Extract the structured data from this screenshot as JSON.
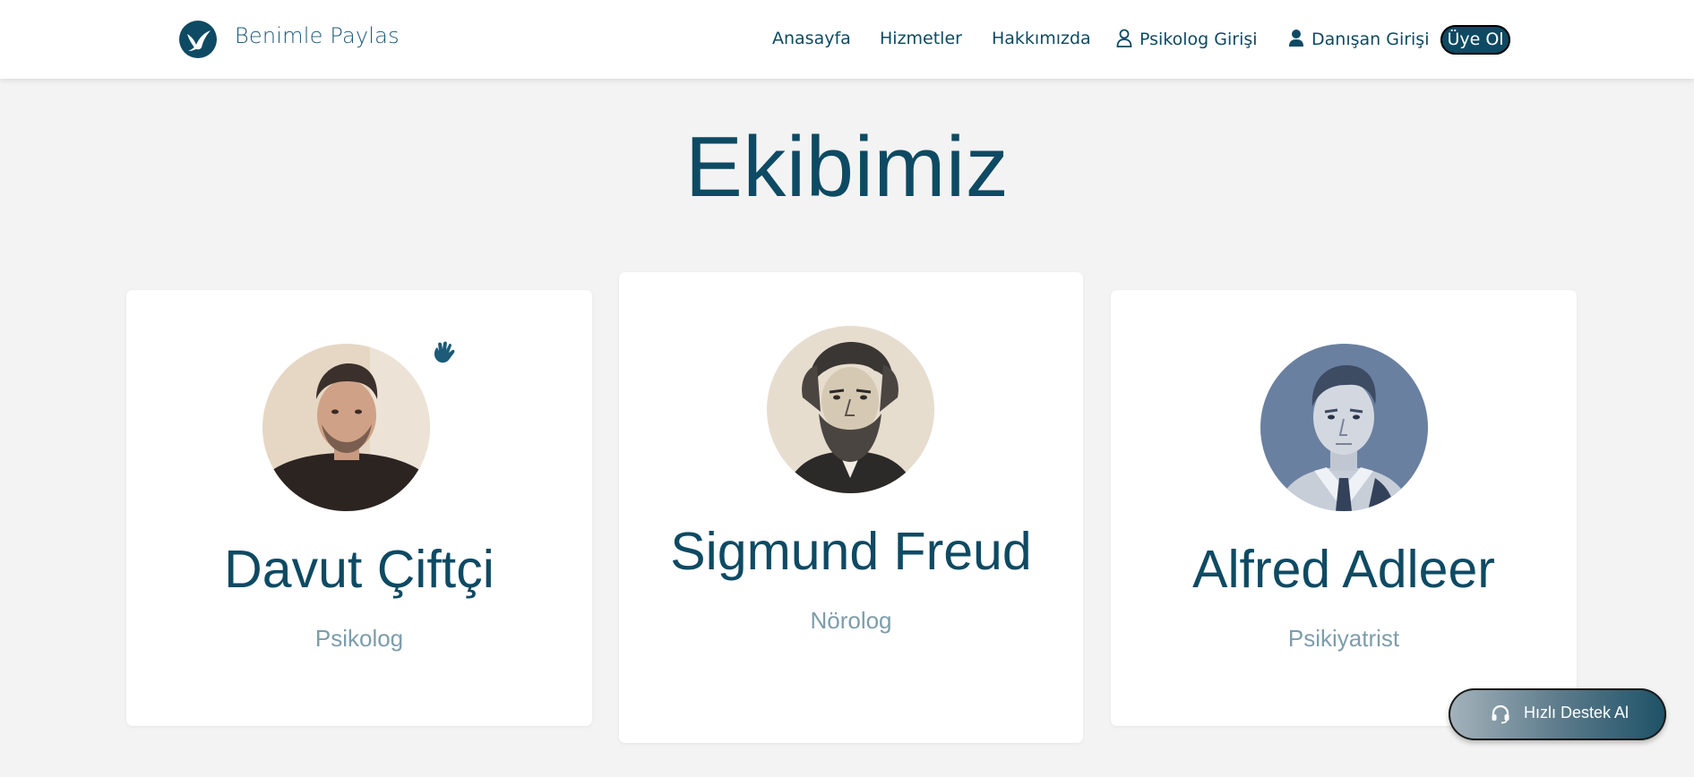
{
  "header": {
    "brand": "Benimle Paylas",
    "nav": {
      "home": "Anasayfa",
      "services": "Hizmetler",
      "about": "Hakkımızda",
      "psychologist_login": "Psikolog Girişi",
      "client_login": "Danışan Girişi",
      "signup": "Üye Ol"
    }
  },
  "page": {
    "title": "Ekibimiz"
  },
  "team": [
    {
      "name": "Davut Çiftçi",
      "role": "Psikolog"
    },
    {
      "name": "Sigmund Freud",
      "role": "Nörolog"
    },
    {
      "name": "Alfred Adleer",
      "role": "Psikiyatrist"
    }
  ],
  "support": {
    "label": "Hızlı Destek Al"
  },
  "colors": {
    "primary": "#0e4a63",
    "background": "#f3f3f3",
    "role_text": "#7d9dab"
  }
}
